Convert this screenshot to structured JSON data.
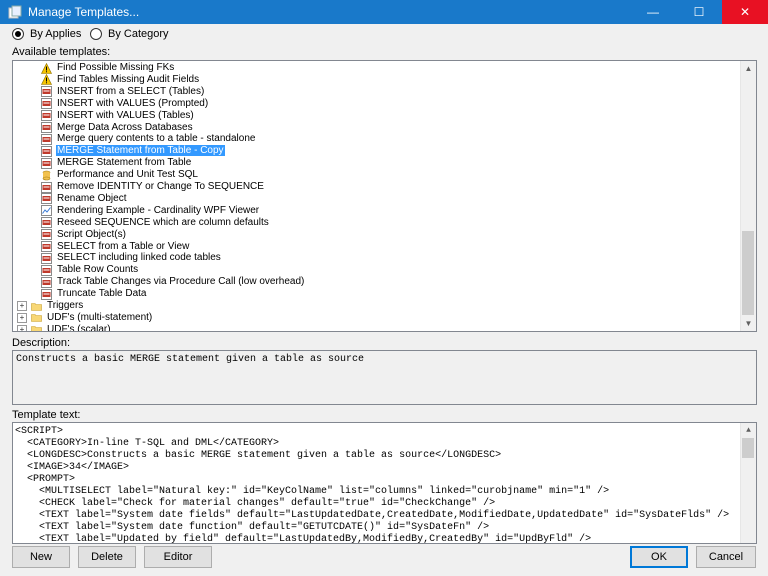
{
  "window": {
    "title": "Manage Templates..."
  },
  "controls": {
    "minimize": "—",
    "maximize": "☐",
    "close": "✕"
  },
  "view_mode": {
    "by_applies": "By Applies",
    "by_category": "By Category",
    "selected": "by_applies"
  },
  "available_label": "Available templates:",
  "tree": {
    "items": [
      {
        "label": "Find Possible Missing FKs",
        "icon": "warning-icon",
        "indent": 2,
        "selected": false
      },
      {
        "label": "Find Tables Missing Audit Fields",
        "icon": "warning-icon",
        "indent": 2,
        "selected": false
      },
      {
        "label": "INSERT from a SELECT (Tables)",
        "icon": "sql-file-icon",
        "indent": 2,
        "selected": false
      },
      {
        "label": "INSERT with VALUES (Prompted)",
        "icon": "sql-file-icon",
        "indent": 2,
        "selected": false
      },
      {
        "label": "INSERT with VALUES (Tables)",
        "icon": "sql-file-icon",
        "indent": 2,
        "selected": false
      },
      {
        "label": "Merge Data Across Databases",
        "icon": "sql-file-icon",
        "indent": 2,
        "selected": false
      },
      {
        "label": "Merge query contents to a table - standalone",
        "icon": "sql-file-icon",
        "indent": 2,
        "selected": false
      },
      {
        "label": "MERGE Statement from Table - Copy",
        "icon": "sql-file-icon",
        "indent": 2,
        "selected": true
      },
      {
        "label": "MERGE Statement from Table",
        "icon": "sql-file-icon",
        "indent": 2,
        "selected": false
      },
      {
        "label": "Performance and Unit Test SQL",
        "icon": "database-icon",
        "indent": 2,
        "selected": false
      },
      {
        "label": "Remove IDENTITY or Change To SEQUENCE",
        "icon": "sql-file-icon",
        "indent": 2,
        "selected": false
      },
      {
        "label": "Rename Object",
        "icon": "sql-file-icon",
        "indent": 2,
        "selected": false
      },
      {
        "label": "Rendering Example - Cardinality WPF Viewer",
        "icon": "chart-icon",
        "indent": 2,
        "selected": false
      },
      {
        "label": "Reseed SEQUENCE which are column defaults",
        "icon": "sql-file-icon",
        "indent": 2,
        "selected": false
      },
      {
        "label": "Script Object(s)",
        "icon": "sql-file-icon",
        "indent": 2,
        "selected": false
      },
      {
        "label": "SELECT from a Table or View",
        "icon": "sql-file-icon",
        "indent": 2,
        "selected": false
      },
      {
        "label": "SELECT including linked code tables",
        "icon": "sql-file-icon",
        "indent": 2,
        "selected": false
      },
      {
        "label": "Table Row Counts",
        "icon": "sql-file-icon",
        "indent": 2,
        "selected": false
      },
      {
        "label": "Track Table Changes via Procedure Call (low overhead)",
        "icon": "sql-file-icon",
        "indent": 2,
        "selected": false
      },
      {
        "label": "Truncate Table Data",
        "icon": "sql-file-icon",
        "indent": 2,
        "selected": false
      },
      {
        "label": "Triggers",
        "icon": "folder-icon",
        "indent": 0,
        "selected": false,
        "expander": "+"
      },
      {
        "label": "UDF's (multi-statement)",
        "icon": "folder-icon",
        "indent": 0,
        "selected": false,
        "expander": "+"
      },
      {
        "label": "UDF's (scalar)",
        "icon": "folder-icon",
        "indent": 0,
        "selected": false,
        "expander": "+"
      }
    ]
  },
  "description": {
    "label": "Description:",
    "text": "Constructs a basic MERGE statement given a table as source"
  },
  "template": {
    "label": "Template text:",
    "lines": [
      "<SCRIPT>",
      "  <CATEGORY>In-line T-SQL and DML</CATEGORY>",
      "  <LONGDESC>Constructs a basic MERGE statement given a table as source</LONGDESC>",
      "  <IMAGE>34</IMAGE>",
      "  <PROMPT>",
      "    <MULTISELECT label=\"Natural key:\" id=\"KeyColName\" list=\"columns\" linked=\"curobjname\" min=\"1\" />",
      "    <CHECK label=\"Check for material changes\" default=\"true\" id=\"CheckChange\" />",
      "    <TEXT label=\"System date fields\" default=\"LastUpdatedDate,CreatedDate,ModifiedDate,UpdatedDate\" id=\"SysDateFlds\" />",
      "    <TEXT label=\"System date function\" default=\"GETUTCDATE()\" id=\"SysDateFn\" />",
      "    <TEXT label=\"Updated by field\" default=\"LastUpdatedBy,ModifiedBy,CreatedBy\" id=\"UpdByFld\" />"
    ]
  },
  "buttons": {
    "new": "New",
    "delete": "Delete",
    "editor": "Editor",
    "ok": "OK",
    "cancel": "Cancel"
  },
  "colors": {
    "titlebar": "#1979ca",
    "selection": "#3399ff",
    "close_hover": "#e81123"
  }
}
